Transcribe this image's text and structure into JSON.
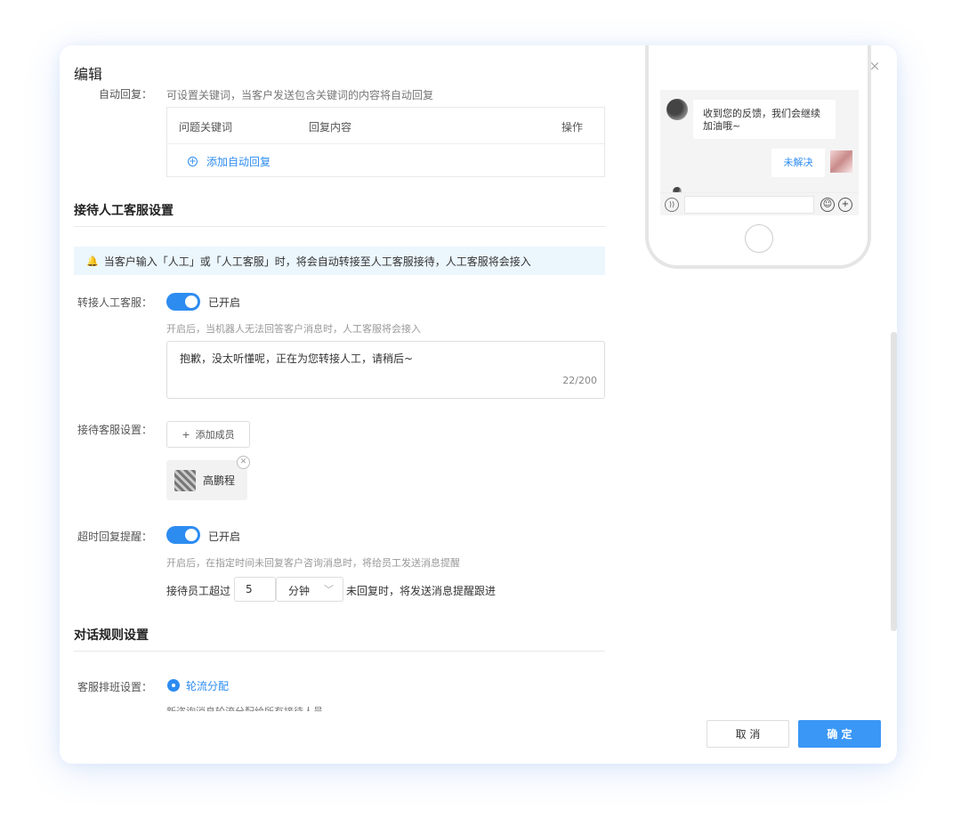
{
  "modal": {
    "title": "编辑",
    "close_icon": "×"
  },
  "auto_reply": {
    "label": "自动回复：",
    "hint": "可设置关键词，当客户发送包含关键词的内容将自动回复",
    "columns": [
      "问题关键词",
      "回复内容",
      "操作"
    ],
    "add_label": "添加自动回复"
  },
  "human_section": {
    "title": "接待人工客服设置",
    "notice": "当客户输入「人工」或「人工客服」时，将会自动转接至人工客服接待，人工客服将会接入",
    "transfer_label": "转接人工客服：",
    "transfer_status": "已开启",
    "transfer_on": true,
    "transfer_hint": "开启后，当机器人无法回答客户消息时，人工客服将会接入",
    "transfer_message": "抱歉，没太听懂呢，正在为您转接人工，请稍后~",
    "char_count": "22/200",
    "reception_label": "接待客服设置：",
    "add_member": "添加成员",
    "member_name": "高鹏程",
    "timeout_label": "超时回复提醒：",
    "timeout_status": "已开启",
    "timeout_on": true,
    "timeout_hint": "开启后，在指定时间未回复客户咨询消息时，将给员工发送消息提醒",
    "timeout_prefix": "接待员工超过",
    "timeout_value": "5",
    "timeout_unit": "分钟",
    "timeout_suffix": "未回复时，将发送消息提醒跟进"
  },
  "rule_section": {
    "title": "对话规则设置",
    "schedule_label": "客服排班设置：",
    "schedule_option": "轮流分配",
    "schedule_hint": "新咨询消息轮流分配给所有接待人员"
  },
  "preview": {
    "bot_message": "收到您的反馈，我们会继续加油哦~",
    "user_reply": "未解决"
  },
  "footer": {
    "cancel": "取 消",
    "confirm": "确 定"
  },
  "colors": {
    "accent": "#2d8cf0",
    "notice_bg": "#ecf6fd",
    "confirm_bg": "#3a97f5"
  }
}
